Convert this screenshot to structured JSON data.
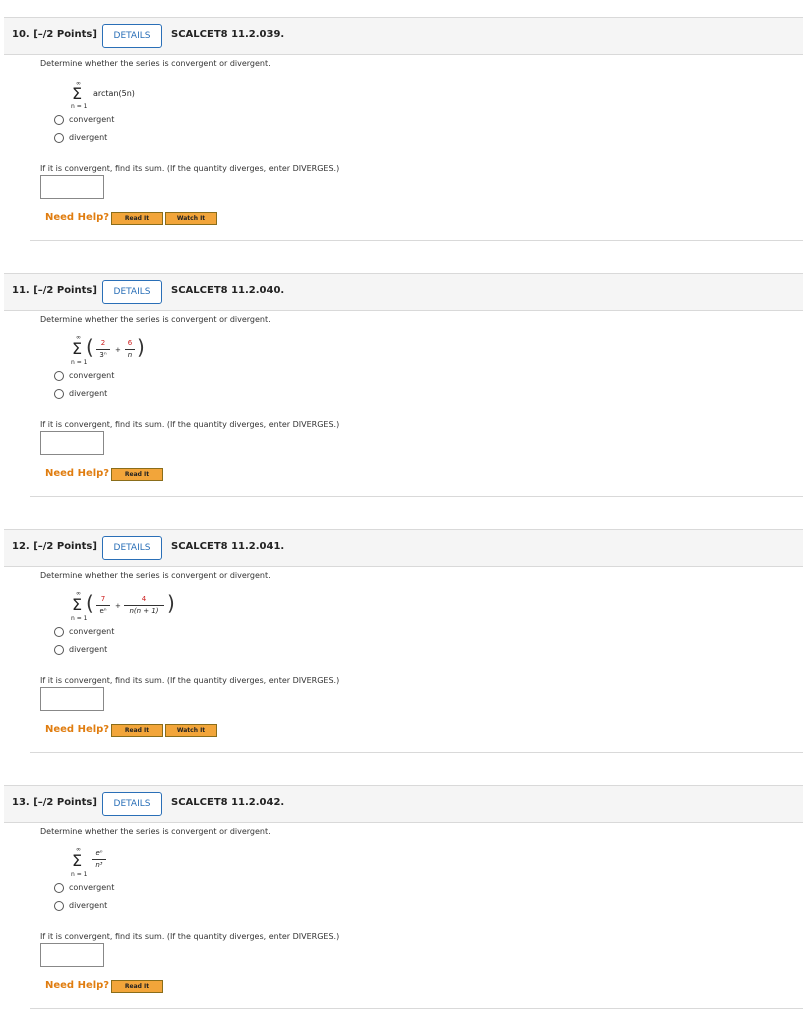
{
  "common": {
    "details_label": "DETAILS",
    "prompt": "Determine whether the series is convergent or divergent.",
    "option_convergent": "convergent",
    "option_divergent": "divergent",
    "sum_prompt": "If it is convergent, find its sum. (If the quantity diverges, enter DIVERGES.)",
    "need_help": "Need Help?",
    "read_it": "Read It",
    "watch_it": "Watch It",
    "sum_upper": "∞",
    "sum_lower": "n = 1",
    "sigma": "Σ"
  },
  "questions": [
    {
      "number": "10.  [–/2 Points]",
      "code": "SCALCET8 11.2.039.",
      "term": "arctan(5n)",
      "answer_value": ""
    },
    {
      "number": "11.  [–/2 Points]",
      "code": "SCALCET8 11.2.040.",
      "f1_num": "2",
      "f1_den": "3ⁿ",
      "plus": "+",
      "f2_num": "6",
      "f2_den": "n",
      "answer_value": ""
    },
    {
      "number": "12.  [–/2 Points]",
      "code": "SCALCET8 11.2.041.",
      "f1_num": "7",
      "f1_den": "eⁿ",
      "plus": "+",
      "f2_num": "4",
      "f2_den": "n(n + 1)",
      "answer_value": ""
    },
    {
      "number": "13.  [–/2 Points]",
      "code": "SCALCET8 11.2.042.",
      "f1_num": "eⁿ",
      "f1_den": "n³",
      "answer_value": ""
    }
  ],
  "colors": {
    "accent_blue": "#2a6fb7",
    "help_orange": "#e07d10",
    "button_orange": "#f2a53a",
    "highlight_red": "#cc1b1b"
  }
}
